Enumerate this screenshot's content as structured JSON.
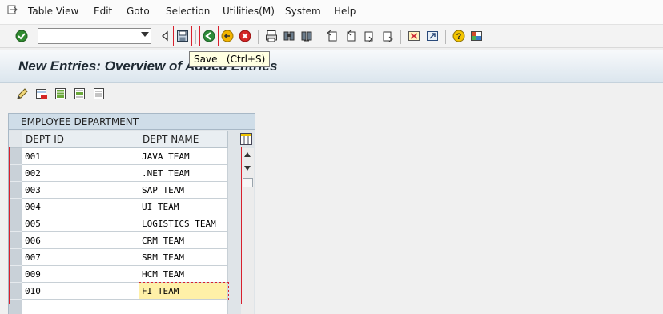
{
  "menubar": {
    "items": [
      {
        "label": "Table View",
        "accel": ""
      },
      {
        "label": "Edit",
        "accel": ""
      },
      {
        "label": "Goto",
        "accel": ""
      },
      {
        "label": "Selection",
        "accel": ""
      },
      {
        "label": "Utilities(M)",
        "accel": ""
      },
      {
        "label": "System",
        "accel": ""
      },
      {
        "label": "Help",
        "accel": ""
      }
    ]
  },
  "toolbar": {
    "command_field_value": "",
    "tooltip": "Save   (Ctrl+S)",
    "icons": [
      "enter-icon",
      "command-dropdown-icon",
      "back-nav-icon",
      "save-icon",
      "back-icon",
      "exit-icon",
      "cancel-icon",
      "print-icon",
      "find-icon",
      "find-next-icon",
      "first-page-icon",
      "prev-page-icon",
      "next-page-icon",
      "last-page-icon",
      "create-session-icon",
      "shortcut-icon",
      "help-icon",
      "layout-icon"
    ]
  },
  "title": {
    "text": "New Entries: Overview of Added Entries"
  },
  "app_toolbar": {
    "icons": [
      "display-change-icon",
      "delete-icon",
      "select-all-icon",
      "select-block-icon",
      "deselect-all-icon"
    ]
  },
  "table": {
    "title": "EMPLOYEE DEPARTMENT",
    "columns": [
      "DEPT ID",
      "DEPT NAME"
    ],
    "rows": [
      {
        "dept_id": "001",
        "dept_name": "JAVA TEAM"
      },
      {
        "dept_id": "002",
        "dept_name": ".NET TEAM"
      },
      {
        "dept_id": "003",
        "dept_name": "SAP TEAM"
      },
      {
        "dept_id": "004",
        "dept_name": "UI TEAM"
      },
      {
        "dept_id": "005",
        "dept_name": "LOGISTICS TEAM"
      },
      {
        "dept_id": "006",
        "dept_name": "CRM TEAM"
      },
      {
        "dept_id": "007",
        "dept_name": "SRM TEAM"
      },
      {
        "dept_id": "009",
        "dept_name": "HCM TEAM"
      },
      {
        "dept_id": "010",
        "dept_name": "FI TEAM"
      },
      {
        "dept_id": "",
        "dept_name": ""
      }
    ]
  },
  "colors": {
    "highlight_red": "#d8202d",
    "active_cell": "#fff0a8",
    "title_bar": "#dce6ee"
  }
}
